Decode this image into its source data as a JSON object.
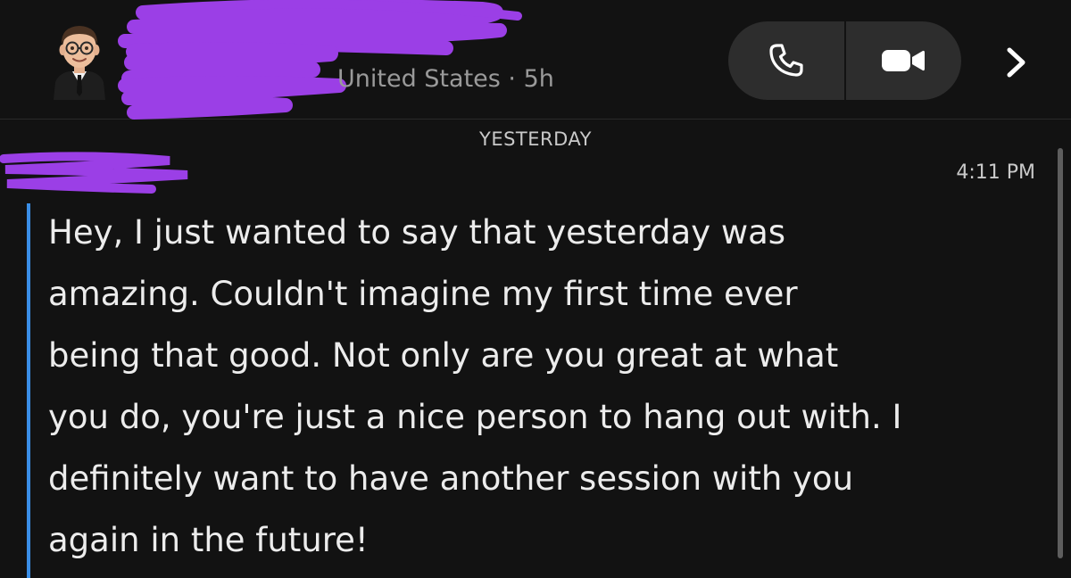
{
  "header": {
    "subtitle": "United States · 5h",
    "avatar_icon": "bitmoji-avatar-icon",
    "phone_icon": "phone-icon",
    "video_icon": "video-camera-icon",
    "chevron_icon": "chevron-right-icon",
    "redaction_color": "#9b3fe6"
  },
  "chat": {
    "day_label": "YESTERDAY",
    "message": {
      "time": "4:11 PM",
      "text": "Hey, I just wanted to say that yesterday was\namazing. Couldn't imagine my first time ever\nbeing that good. Not only are you great at what\nyou do, you're just a nice person to hang out with. I\ndefinitely want to have another session with you\nagain in the future!",
      "accent_color": "#3a8ee6"
    }
  }
}
